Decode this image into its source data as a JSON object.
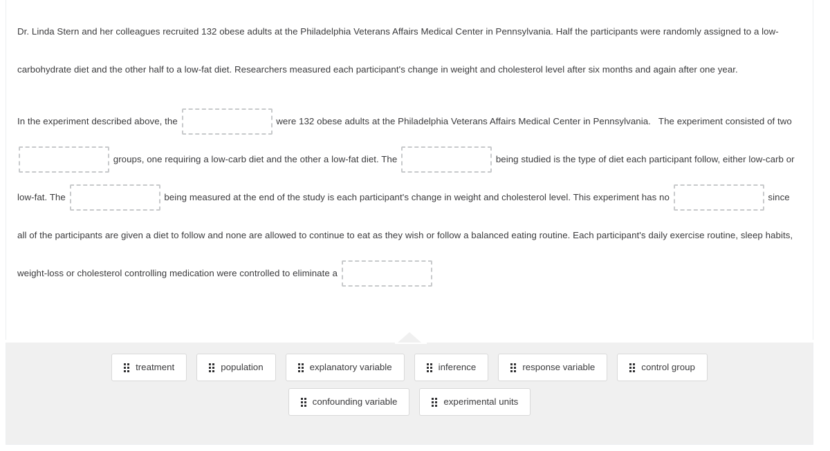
{
  "question": {
    "scenario": "Dr. Linda Stern and her colleagues recruited 132 obese adults at the Philadelphia Veterans Affairs Medical Center in Pennsylvania. Half the participants were randomly assigned to a low-carbohydrate diet and the other half to a low-fat diet. Researchers measured each participant's change in weight and cholesterol level after six months and again after one year.",
    "fill_in": {
      "segments": [
        "In the experiment described above, the ",
        " were 132 obese adults at the Philadelphia Veterans Affairs Medical Center in Pennsylvania.   The experiment consisted of two ",
        " groups, one requiring a low-carb diet and the other a low-fat diet. The ",
        " being studied is the type of diet each participant follow, either low-carb or low-fat. The ",
        " being measured at the end of the study is each participant's change in weight and cholesterol level. This experiment has no ",
        " since all of the participants are given a diet to follow and none are allowed to continue to eat as they wish or follow a balanced eating routine. Each participant's daily exercise routine, sleep habits, weight-loss or cholesterol controlling medication were controlled to eliminate a ",
        ""
      ],
      "blanks": [
        {
          "id": "blank-1",
          "value": ""
        },
        {
          "id": "blank-2",
          "value": ""
        },
        {
          "id": "blank-3",
          "value": ""
        },
        {
          "id": "blank-4",
          "value": ""
        },
        {
          "id": "blank-5",
          "value": ""
        },
        {
          "id": "blank-6",
          "value": ""
        }
      ]
    }
  },
  "answer_tray": {
    "row1": [
      {
        "label": "treatment"
      },
      {
        "label": "population"
      },
      {
        "label": "explanatory variable"
      },
      {
        "label": "inference"
      },
      {
        "label": "response variable"
      },
      {
        "label": "control group"
      }
    ],
    "row2": [
      {
        "label": "confounding variable"
      },
      {
        "label": "experimental units"
      }
    ],
    "handle_icon": "drag-handle-icon"
  },
  "colors": {
    "text": "#3a3a3c",
    "tray_bg": "#f0f0f0",
    "chip_border": "#d8d8d8",
    "dropzone_border": "#c7c9cb",
    "card_border": "#eceef0"
  }
}
